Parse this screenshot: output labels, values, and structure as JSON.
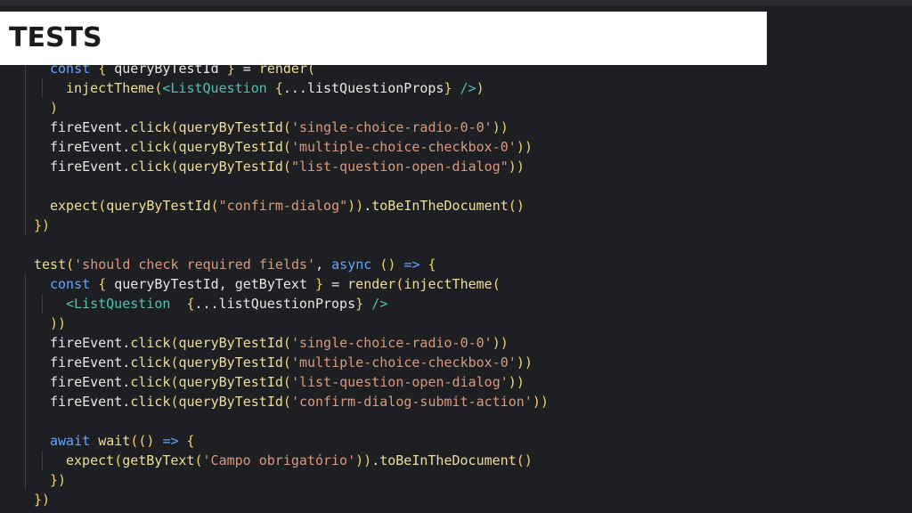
{
  "slide": {
    "title": "TESTS"
  },
  "code": {
    "lines": [
      "const { queryByTestId } = render(",
      "injectTheme(<ListQuestion {...listQuestionProps} />)",
      ")",
      "fireEvent.click(queryByTestId('single-choice-radio-0-0'))",
      "fireEvent.click(queryByTestId('multiple-choice-checkbox-0'))",
      "fireEvent.click(queryByTestId(\"list-question-open-dialog\"))",
      "",
      "expect(queryByTestId(\"confirm-dialog\")).toBeInTheDocument()",
      "})",
      "",
      "test('should check required fields', async () => {",
      "const { queryByTestId, getByText } = render(injectTheme(",
      "<ListQuestion  {...listQuestionProps} />",
      "))",
      "fireEvent.click(queryByTestId('single-choice-radio-0-0'))",
      "fireEvent.click(queryByTestId('multiple-choice-checkbox-0'))",
      "fireEvent.click(queryByTestId('list-question-open-dialog'))",
      "fireEvent.click(queryByTestId('confirm-dialog-submit-action'))",
      "",
      "await wait(() => {",
      "expect(getByText('Campo obrigatório')).toBeInTheDocument()",
      "})",
      "})"
    ]
  }
}
